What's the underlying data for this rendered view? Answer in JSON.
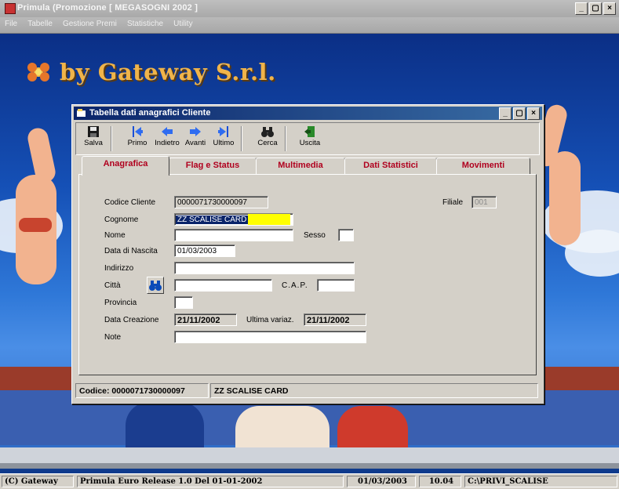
{
  "window": {
    "title": "Primula  (Promozione [ MEGASOGNI 2002 ]",
    "controls": [
      "_",
      "▢",
      "×"
    ]
  },
  "menu": [
    "File",
    "Tabelle",
    "Gestione Premi",
    "Statistiche",
    "Utility"
  ],
  "logo": {
    "text": "by Gateway S.r.l."
  },
  "dialog": {
    "title": "Tabella dati anagrafici Cliente",
    "controls": [
      "_",
      "▢",
      "×"
    ],
    "toolbar": [
      {
        "label": "Salva",
        "icon": "floppy-icon"
      },
      {
        "label": "Primo",
        "icon": "first-arrow-icon"
      },
      {
        "label": "Indietro",
        "icon": "back-arrow-icon"
      },
      {
        "label": "Avanti",
        "icon": "forward-arrow-icon"
      },
      {
        "label": "Ultimo",
        "icon": "last-arrow-icon"
      },
      {
        "label": "Cerca",
        "icon": "binoculars-icon"
      },
      {
        "label": "Uscita",
        "icon": "exit-door-icon"
      }
    ],
    "tabs": [
      "Anagrafica",
      "Flag e Status",
      "Multimedia",
      "Dati Statistici",
      "Movimenti"
    ],
    "active_tab": "Anagrafica",
    "form": {
      "codice_cliente": {
        "label": "Codice Cliente",
        "value": "0000071730000097"
      },
      "filiale": {
        "label": "Filiale",
        "value": "001"
      },
      "cognome": {
        "label": "Cognome",
        "value": "ZZ SCALISE CARD"
      },
      "nome": {
        "label": "Nome",
        "value": ""
      },
      "sesso": {
        "label": "Sesso",
        "value": ""
      },
      "data_nascita": {
        "label": "Data di Nascita",
        "value": "01/03/2003"
      },
      "indirizzo": {
        "label": "Indirizzo",
        "value": ""
      },
      "citta": {
        "label": "Città",
        "value": ""
      },
      "cap": {
        "label": "C.A.P.",
        "value": ""
      },
      "provincia": {
        "label": "Provincia",
        "value": ""
      },
      "data_creazione": {
        "label": "Data Creazione",
        "value": "21/11/2002"
      },
      "ultima_variaz": {
        "label": "Ultima variaz.",
        "value": "21/11/2002"
      },
      "note": {
        "label": "Note",
        "value": ""
      }
    },
    "status": {
      "codice": "Codice: 0000071730000097",
      "nome": "ZZ SCALISE CARD"
    }
  },
  "statusbar": {
    "copyright": "(C) Gateway",
    "release": "Primula Euro Release 1.0   Del  01-01-2002",
    "date": "01/03/2003",
    "time": "10.04",
    "path": "C:\\PRIVI_SCALISE"
  }
}
